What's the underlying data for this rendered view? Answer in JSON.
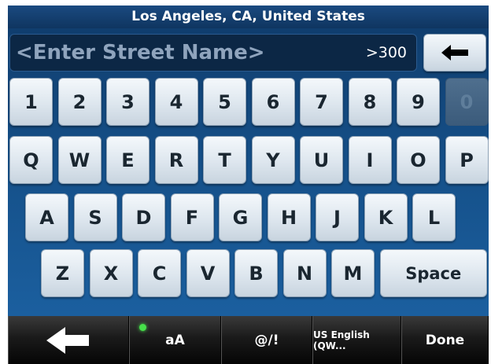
{
  "header": {
    "location": "Los Angeles, CA, United States"
  },
  "search": {
    "placeholder": "<Enter Street Name>",
    "result_count": ">300"
  },
  "keyboard": {
    "rows": [
      [
        "1",
        "2",
        "3",
        "4",
        "5",
        "6",
        "7",
        "8",
        "9",
        "0"
      ],
      [
        "Q",
        "W",
        "E",
        "R",
        "T",
        "Y",
        "U",
        "I",
        "O",
        "P"
      ],
      [
        "A",
        "S",
        "D",
        "F",
        "G",
        "H",
        "J",
        "K",
        "L"
      ],
      [
        "Z",
        "X",
        "C",
        "V",
        "B",
        "N",
        "M",
        "Space"
      ]
    ],
    "disabled_keys": [
      "0"
    ]
  },
  "bottom_bar": {
    "case_label": "aA",
    "symbols_label": "@/!",
    "language_label": "US English (QW...",
    "done_label": "Done"
  },
  "icons": {
    "backspace": "backspace-arrow-icon",
    "back": "back-arrow-icon"
  },
  "colors": {
    "accent": "#1d64a6",
    "case_indicator": "#46e04a"
  }
}
